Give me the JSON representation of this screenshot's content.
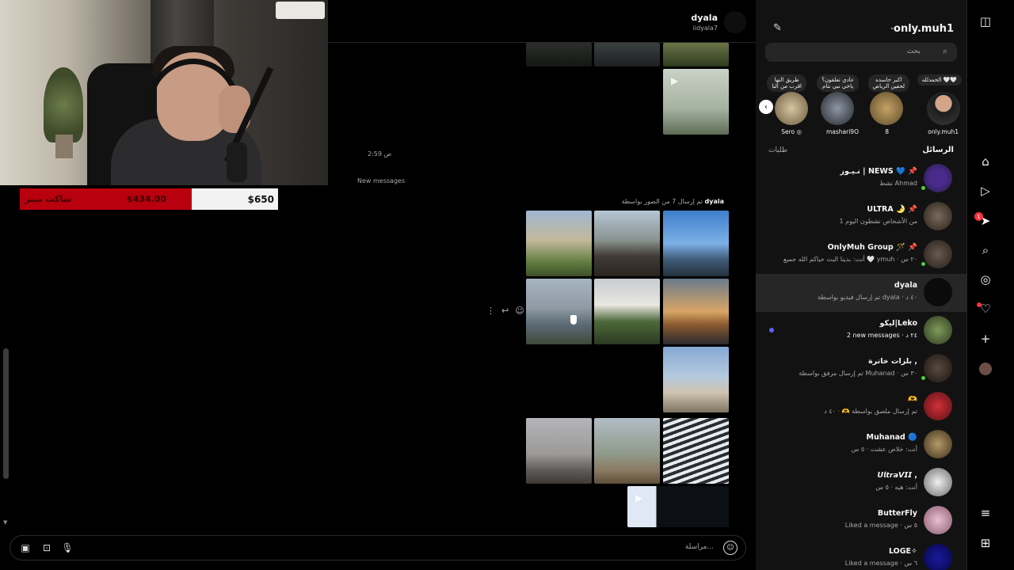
{
  "overlay": {
    "alert_left": "شاكت ميتر",
    "alert_amount": "$434.00",
    "alert_goal": "$650"
  },
  "chat": {
    "name": "dyala",
    "username": "iidyala7",
    "timestamp": "2:59 ص",
    "new_messages": "New messages",
    "sent_note_prefix": "تم إرسال 7 من الصور بواسطة",
    "sent_note_user": "dyala",
    "composer_placeholder": "مراسلة..."
  },
  "inbox": {
    "account": "only.muh1",
    "search_placeholder": "بحث",
    "tab_messages": "الرسائل",
    "tab_requests": "طلبات",
    "notes": [
      {
        "text": "الحمدلله 🤍🤍",
        "name": "only.muh1"
      },
      {
        "text": "اكبر حاسده\nلحفين الرياض",
        "name": "8"
      },
      {
        "text": "عادي تعلقون؟\nياخي نبي ننام",
        "name": "mashari9O"
      },
      {
        "text": "طريق النها\nاقرب من البا",
        "name": "Sero ◎"
      }
    ],
    "conversations": [
      {
        "name": "نـيـوز | NEWS 💙 📌",
        "sub": "نشط Ahmad",
        "bold": false
      },
      {
        "name": "ULTRA 🌛 📌",
        "sub": "1 من الأشخاص نشطون اليوم",
        "bold": false
      },
      {
        "name": "OnlyMuh Group 🪄 📌",
        "sub": "أنت: بدينا البث حياكم الله جميع 🤍 ymuh · ٢٠ س",
        "bold": false
      },
      {
        "name": "dyala",
        "sub": "تم إرسال فيديو بواسطة dyala · ٤٠ د",
        "bold": false
      },
      {
        "name": "ليكو|Leko",
        "sub": "2 new messages · ٢٤ د",
        "bold": true
      },
      {
        "name": "بلزات خاترة ,",
        "sub": "تم إرسال مرفق بواسطة Muhanad · ٣٠ س",
        "bold": false
      },
      {
        "name": "🫶",
        "sub": "تم إرسال ملصق بواسطة 🫶 · ٤٠ د",
        "bold": false
      },
      {
        "name": "Muhanad 🔵",
        "sub": "أنت: خلاص عشت · ٥ س",
        "bold": false
      },
      {
        "name": "𝙐𝙡𝙩𝙧𝙖𝙑𝙄𝙄 ,",
        "sub": "أنت: هيه · ٥ س",
        "bold": false
      },
      {
        "name": "ButterFly",
        "sub": "Liked a message · ٥ س",
        "bold": false
      },
      {
        "name": "LOGE✧",
        "sub": "Liked a message · ٦ س",
        "bold": false
      }
    ]
  },
  "rail": {
    "badge_count": "1"
  },
  "icons": {
    "instagram": "instagram-icon",
    "home": "home-icon",
    "reels": "reels-icon",
    "messages": "messenger-icon",
    "search": "search-icon",
    "explore": "compass-icon",
    "notifications": "heart-icon",
    "create": "plus-icon",
    "menu": "menu-icon",
    "apps": "grid-icon"
  },
  "colors": {
    "background": "#000000",
    "panel": "#121212",
    "active_row": "#262626",
    "online": "#4cd137",
    "unread": "#5865f2",
    "badge": "#ff3040",
    "alert_red": "#b8000f"
  }
}
